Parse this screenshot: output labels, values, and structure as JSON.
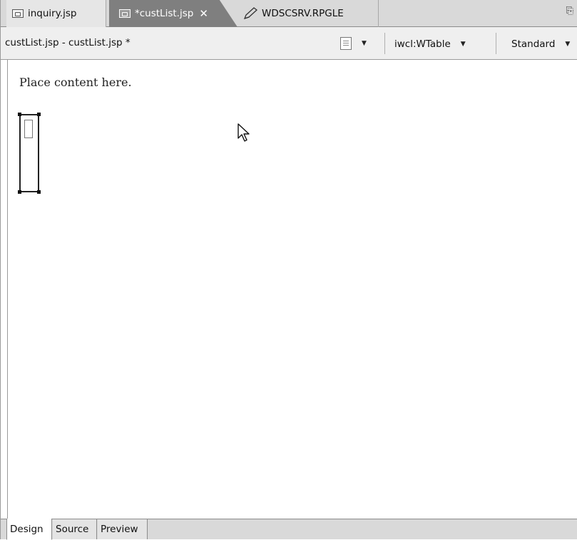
{
  "editor_tabs": [
    {
      "label": "inquiry.jsp",
      "icon": "jsp-file-icon",
      "active": false
    },
    {
      "label": "*custList.jsp",
      "icon": "jsp-file-icon",
      "active": true,
      "closable": true
    },
    {
      "label": "WDSCSRV.RPGLE",
      "icon": "pencil-icon",
      "active": false
    }
  ],
  "toolbar": {
    "title": "custList.jsp - custList.jsp *",
    "tag_combo": "iwcl:WTable",
    "mode_combo": "Standard"
  },
  "canvas": {
    "placeholder_text": "Place content here."
  },
  "view_tabs": [
    {
      "label": "Design",
      "active": true
    },
    {
      "label": "Source",
      "active": false
    },
    {
      "label": "Preview",
      "active": false
    }
  ],
  "colors": {
    "active_tab_bg": "#7f7f7f",
    "tabbar_bg": "#d9d9d9",
    "toolbar_bg": "#efefef"
  }
}
